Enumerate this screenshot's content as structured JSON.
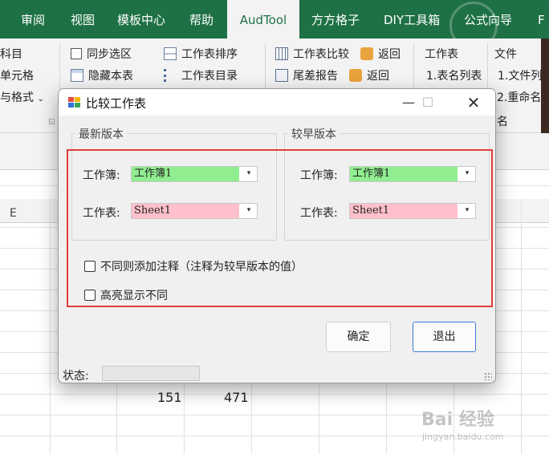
{
  "ribbon_tabs": [
    "审阅",
    "视图",
    "模板中心",
    "帮助",
    "AudTool",
    "方方格子",
    "DIY工具箱",
    "公式向导",
    "F"
  ],
  "active_tab": "AudTool",
  "ribbon": {
    "left_items": [
      "科目",
      "单元格",
      "与格式"
    ],
    "sync_select": "同步选区",
    "hide_sheet": "隐藏本表",
    "sheet_sort": "工作表排序",
    "sheet_toc": "工作表目录",
    "sheet_compare": "工作表比较",
    "diff_report": "尾差报告",
    "back_1": "返回",
    "back_2": "返回",
    "sheet_group": "工作表",
    "sheet_name_list": "1.表名列表",
    "file_group": "文件",
    "file_list": "1.文件列",
    "rename": "2.重命名",
    "rename_tail": "名"
  },
  "sheet": {
    "column_label": "E",
    "cells": [
      "151",
      "471"
    ]
  },
  "dialog": {
    "title": "比较工作表",
    "newest": {
      "legend": "最新版本",
      "workbook_label": "工作簿:",
      "workbook_value": "工作簿1",
      "sheet_label": "工作表:",
      "sheet_value": "Sheet1"
    },
    "earlier": {
      "legend": "较早版本",
      "workbook_label": "工作簿:",
      "workbook_value": "工作簿1",
      "sheet_label": "工作表:",
      "sheet_value": "Sheet1"
    },
    "option_add_comment": "不同则添加注释（注释为较早版本的值）",
    "option_highlight": "高亮显示不同",
    "ok_button": "确定",
    "exit_button": "退出",
    "status_label": "状态:"
  },
  "watermark": {
    "brand": "Bai 经验",
    "url": "jingyan.baidu.com"
  },
  "colors": {
    "ribbon_green": "#1e7145",
    "workbook_combo_bg": "#90ee90",
    "sheet_combo_bg": "#ffc0cb",
    "highlight_border": "#e23b3b"
  }
}
